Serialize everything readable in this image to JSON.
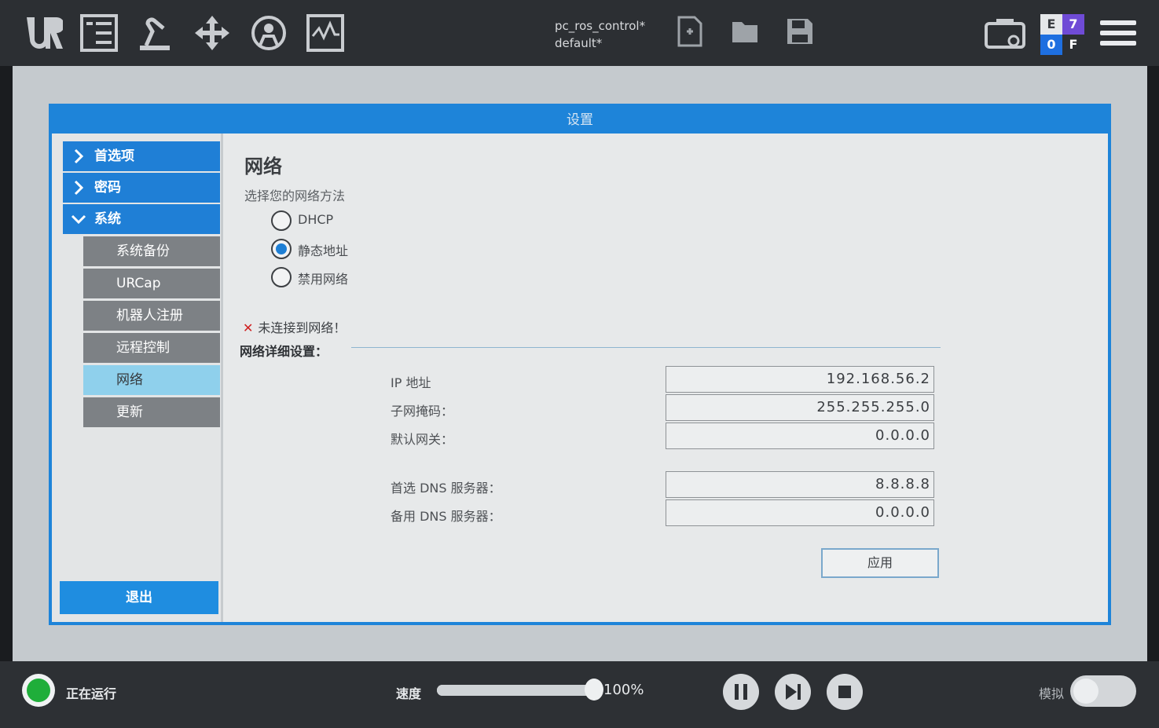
{
  "toolbar": {
    "program_name": "pc_ros_control*",
    "installation_name": "default*",
    "icons": [
      "ur-logo-icon",
      "program-icon",
      "installation-icon",
      "move-icon",
      "io-icon",
      "log-icon",
      "new-file-icon",
      "open-folder-icon",
      "save-icon",
      "local-control-icon",
      "hamburger-icon"
    ],
    "badge": {
      "e": "E",
      "seven": "7",
      "zero": "0",
      "f": "F"
    }
  },
  "dialog": {
    "title": "设置"
  },
  "sidebar": {
    "groups": [
      {
        "label": "首选项",
        "expanded": false
      },
      {
        "label": "密码",
        "expanded": false
      },
      {
        "label": "系统",
        "expanded": true
      }
    ],
    "sub_items": [
      {
        "label": "系统备份"
      },
      {
        "label": "URCap"
      },
      {
        "label": "机器人注册"
      },
      {
        "label": "远程控制"
      },
      {
        "label": "网络",
        "active": true
      },
      {
        "label": "更新"
      }
    ],
    "exit_label": "退出"
  },
  "network": {
    "title": "网络",
    "subtitle": "选择您的网络方法",
    "options": [
      {
        "label": "DHCP",
        "checked": false
      },
      {
        "label": "静态地址",
        "checked": true
      },
      {
        "label": "禁用网络",
        "checked": false
      }
    ],
    "status": "未连接到网络！",
    "details_label": "网络详细设置：",
    "fields": [
      {
        "label": "IP 地址",
        "value": "192.168.56.2"
      },
      {
        "label": "子网掩码：",
        "value": "255.255.255.0"
      },
      {
        "label": "默认网关：",
        "value": "0.0.0.0"
      },
      {
        "label": "首选 DNS 服务器：",
        "value": "8.8.8.8"
      },
      {
        "label": "备用 DNS 服务器：",
        "value": "0.0.0.0"
      }
    ],
    "apply_label": "应用"
  },
  "footer": {
    "status": "正在运行",
    "status_color": "#1fae3a",
    "speed_label": "速度",
    "speed_value": "100%",
    "speed_fraction": 1.0,
    "simulation_label": "模拟",
    "simulation_on": false
  },
  "colors": {
    "accent": "#1f7fd6",
    "active_item": "#8fd0ec",
    "error": "#cf1f1f"
  }
}
